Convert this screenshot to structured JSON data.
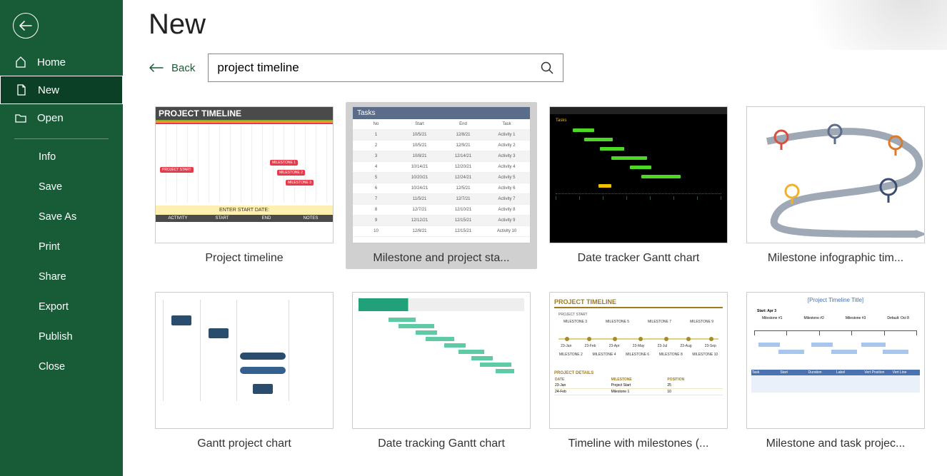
{
  "sidebar": {
    "nav": [
      {
        "label": "Home"
      },
      {
        "label": "New"
      },
      {
        "label": "Open"
      }
    ],
    "sub": [
      {
        "label": "Info"
      },
      {
        "label": "Save"
      },
      {
        "label": "Save As"
      },
      {
        "label": "Print"
      },
      {
        "label": "Share"
      },
      {
        "label": "Export"
      },
      {
        "label": "Publish"
      },
      {
        "label": "Close"
      }
    ]
  },
  "page": {
    "title": "New",
    "back_label": "Back"
  },
  "search": {
    "value": "project timeline",
    "placeholder": ""
  },
  "templates": [
    {
      "label": "Project timeline"
    },
    {
      "label": "Milestone and project sta..."
    },
    {
      "label": "Date tracker Gantt chart"
    },
    {
      "label": "Milestone infographic tim..."
    },
    {
      "label": "Gantt project chart"
    },
    {
      "label": "Date tracking Gantt chart"
    },
    {
      "label": "Timeline with milestones (..."
    },
    {
      "label": "Milestone and task projec..."
    }
  ],
  "thumbs": {
    "t1": {
      "title": "PROJECT TIMELINE",
      "tags": [
        "PROJECT START",
        "MILESTONE 1",
        "MILESTONE 2",
        "MILESTONE 3"
      ],
      "footer": "ENTER START DATE:",
      "cols": [
        "ACTIVITY",
        "START",
        "END",
        "NOTES"
      ]
    },
    "t2": {
      "title": "Tasks",
      "head": [
        "No",
        "Start",
        "End",
        "Task"
      ],
      "rows": [
        [
          "1",
          "10/5/21",
          "12/8/21",
          "Activity 1"
        ],
        [
          "2",
          "10/5/21",
          "12/9/21",
          "Activity 2"
        ],
        [
          "3",
          "10/8/21",
          "12/14/21",
          "Activity 3"
        ],
        [
          "4",
          "10/14/21",
          "12/20/21",
          "Activity 4"
        ],
        [
          "5",
          "10/20/21",
          "12/24/21",
          "Activity 5"
        ],
        [
          "6",
          "10/24/21",
          "12/5/21",
          "Activity 6"
        ],
        [
          "7",
          "11/5/21",
          "12/7/21",
          "Activity 7"
        ],
        [
          "8",
          "12/7/21",
          "12/10/21",
          "Activity 8"
        ],
        [
          "9",
          "12/12/21",
          "12/15/21",
          "Activity 9"
        ],
        [
          "10",
          "12/8/21",
          "12/15/21",
          "Activity 10"
        ]
      ]
    },
    "t3": {
      "title": "Tasks"
    },
    "t7": {
      "title": "PROJECT TIMELINE",
      "project_start": "PROJECT START",
      "ms": [
        "MILESTONE 3",
        "MILESTONE 5",
        "MILESTONE 7",
        "MILESTONE 9"
      ],
      "dates": [
        "23-Jan",
        "23-Feb",
        "23-Apr",
        "23-May",
        "23-Jul",
        "23-Aug",
        "23-Sep"
      ],
      "ms2": [
        "MILESTONE 2",
        "MILESTONE 4",
        "MILESTONE 6",
        "MILESTONE 8",
        "MILESTONE 10"
      ],
      "pd": "PROJECT DETAILS",
      "h": [
        "DATE",
        "MILESTONE",
        "POSITION"
      ],
      "r1": [
        "23-Jan",
        "Project Start",
        "25"
      ],
      "r2": [
        "24-Feb",
        "Milestone 1",
        "10"
      ]
    },
    "t8": {
      "title": "[Project Timeline Title]",
      "start": "Start: Apr 3",
      "ms": [
        "Milestone #1",
        "Milestone #2",
        "Milestone #3",
        "Default: Oct 8"
      ]
    }
  }
}
